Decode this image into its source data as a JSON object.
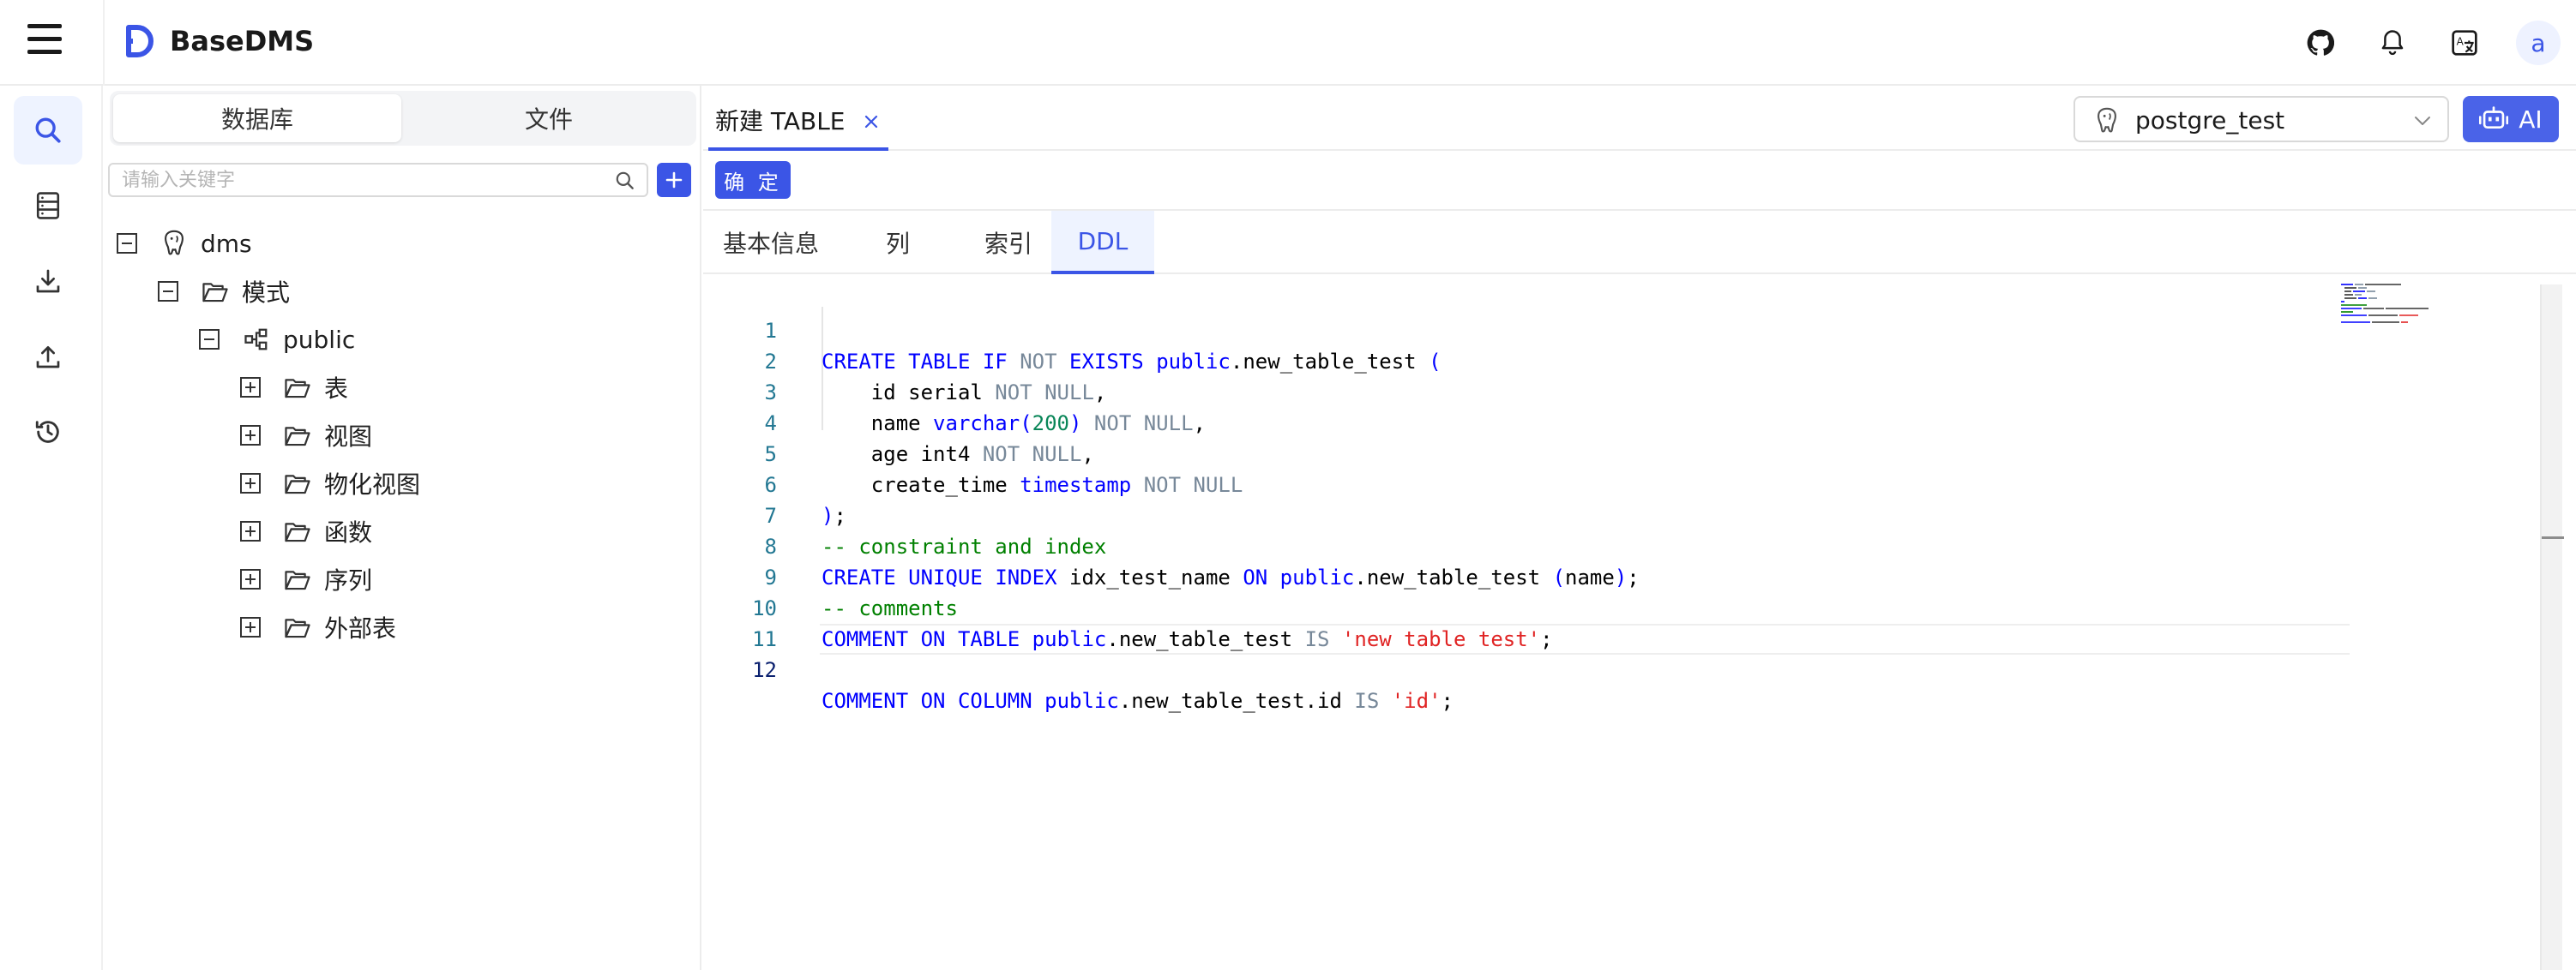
{
  "header": {
    "app_title": "BaseDMS",
    "icons": [
      "menu-icon",
      "github-icon",
      "bell-icon",
      "translate-icon"
    ],
    "avatar_letter": "a",
    "accent_color": "#3b55e6"
  },
  "rail": {
    "items": [
      {
        "name": "search",
        "icon": "search-icon",
        "active": true
      },
      {
        "name": "server",
        "icon": "server-icon",
        "active": false
      },
      {
        "name": "download",
        "icon": "download-icon",
        "active": false
      },
      {
        "name": "upload",
        "icon": "upload-icon",
        "active": false
      },
      {
        "name": "history",
        "icon": "history-icon",
        "active": false
      }
    ]
  },
  "sidebar": {
    "segments": [
      "数据库",
      "文件"
    ],
    "active_segment": "数据库",
    "search_placeholder": "请输入关键字",
    "search_value": "",
    "tree": {
      "root": "dms",
      "schema_folder": "模式",
      "schema": "public",
      "folders": [
        "表",
        "视图",
        "物化视图",
        "函数",
        "序列",
        "外部表"
      ]
    }
  },
  "main": {
    "tab_label": "新建 TABLE",
    "datasource": "postgre_test",
    "ai_label": "AI",
    "confirm_label": "确 定",
    "subtabs": [
      "基本信息",
      "列",
      "索引",
      "DDL"
    ],
    "active_subtab": "DDL",
    "current_line": 12,
    "line_numbers": [
      "1",
      "2",
      "3",
      "4",
      "5",
      "6",
      "7",
      "8",
      "9",
      "10",
      "11",
      "12"
    ],
    "code_lines": [
      "CREATE TABLE IF NOT EXISTS public.new_table_test (",
      "    id serial NOT NULL,",
      "    name varchar(200) NOT NULL,",
      "    age int4 NOT NULL,",
      "    create_time timestamp NOT NULL",
      ");",
      "-- constraint and index",
      "CREATE UNIQUE INDEX idx_test_name ON public.new_table_test (name);",
      "-- comments",
      "COMMENT ON TABLE public.new_table_test IS 'new table test';",
      "",
      "COMMENT ON COLUMN public.new_table_test.id IS 'id';"
    ]
  }
}
